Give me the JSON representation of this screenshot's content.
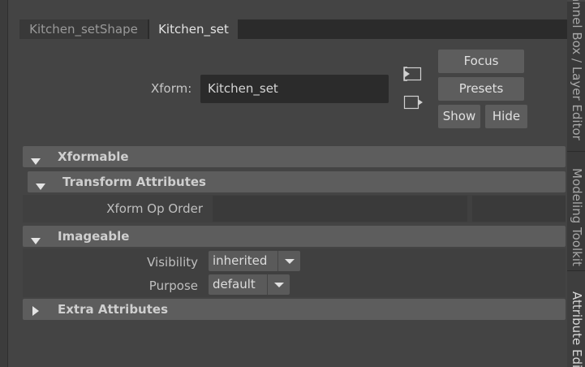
{
  "tabs": [
    {
      "label": "Kitchen_setShape"
    },
    {
      "label": "Kitchen_set"
    }
  ],
  "xform": {
    "label": "Xform:",
    "value": "Kitchen_set"
  },
  "buttons": {
    "focus": "Focus",
    "presets": "Presets",
    "show": "Show",
    "hide": "Hide"
  },
  "icons": {
    "copy_tab": "copy-tab-icon",
    "paste_tab": "paste-tab-icon",
    "expand": "triangle-down-icon",
    "collapse": "triangle-right-icon"
  },
  "sections": {
    "xformable": "Xformable",
    "transform_attributes": "Transform Attributes",
    "imageable": "Imageable",
    "extra_attributes": "Extra Attributes"
  },
  "attributes": {
    "xform_op_order": {
      "label": "Xform Op Order",
      "value": ""
    },
    "visibility": {
      "label": "Visibility",
      "value": "inherited"
    },
    "purpose": {
      "label": "Purpose",
      "value": "default"
    }
  },
  "side_tabs": [
    {
      "label": "Channel Box / Layer Editor"
    },
    {
      "label": "Modeling Toolkit"
    },
    {
      "label": "Attribute Editor"
    }
  ],
  "colors": {
    "panel_bg": "#444444",
    "header_bg": "#5d5d5d",
    "field_bg": "#2b2b2b",
    "text": "#bdbdbd"
  }
}
